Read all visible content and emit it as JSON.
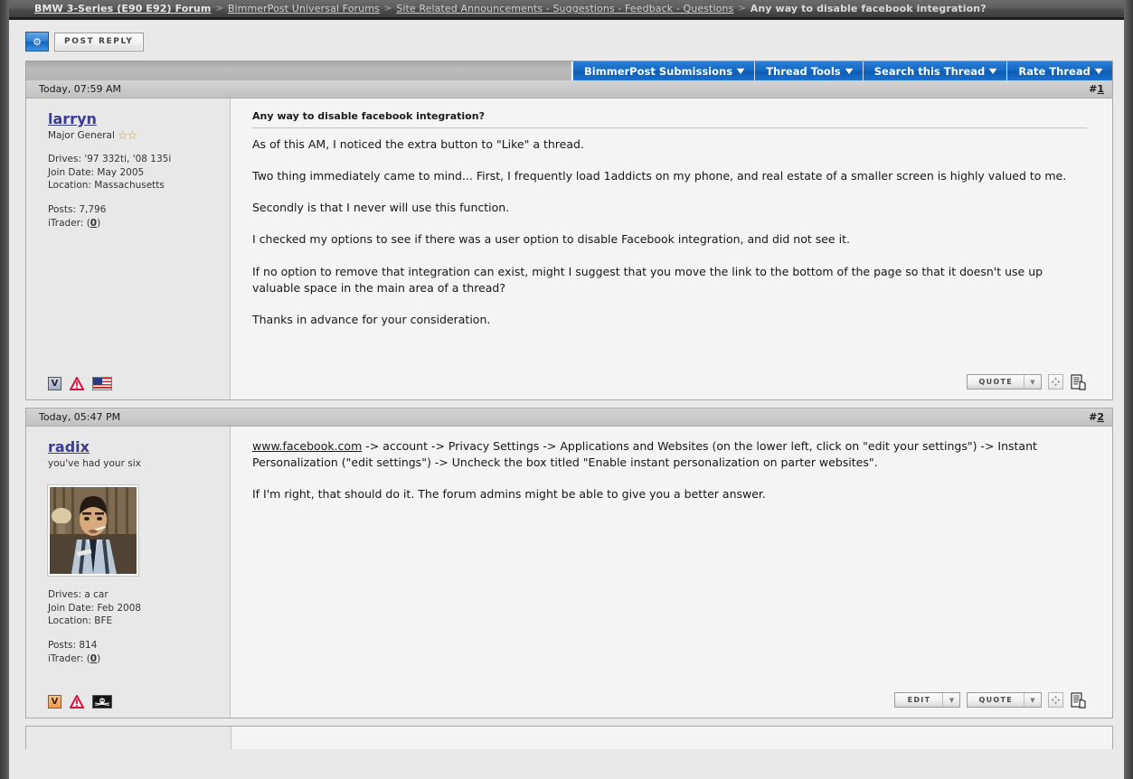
{
  "breadcrumb": {
    "items": [
      {
        "label": "BMW 3-Series (E90 E92) Forum",
        "style": "bold-link"
      },
      {
        "label": "BimmerPost Universal Forums",
        "style": "link"
      },
      {
        "label": "Site Related Announcements - Suggestions - Feedback - Questions",
        "style": "link"
      },
      {
        "label": "Any way to disable facebook integration?",
        "style": "current"
      }
    ],
    "separator": ">"
  },
  "toolbar": {
    "new_icon": "new-thread-icon",
    "post_reply_label": "Post Reply"
  },
  "tabs": [
    {
      "label": "BimmerPost Submissions",
      "caret": "▼"
    },
    {
      "label": "Thread Tools",
      "caret": "▼"
    },
    {
      "label": "Search this Thread",
      "caret": "▼"
    },
    {
      "label": "Rate Thread",
      "caret": "▼"
    }
  ],
  "posts": [
    {
      "timestamp": "Today, 07:59 AM",
      "number_prefix": "#",
      "number": "1",
      "user": {
        "name": "larryn",
        "title": "Major General",
        "stars": "☆☆",
        "star_count": 2,
        "drives_label": "Drives:",
        "drives": "'97 332ti, '08 135i",
        "join_label": "Join Date:",
        "join_date": "May 2005",
        "location_label": "Location:",
        "location": "Massachusetts",
        "posts_label": "Posts:",
        "posts": "7,796",
        "itrader_label": "iTrader:",
        "itrader_open": "(",
        "itrader_count": "0",
        "itrader_close": ")",
        "has_avatar": false,
        "badges": [
          "v-badge-icon",
          "report-warning-icon",
          "us-flag-icon"
        ]
      },
      "title": "Any way to disable facebook integration?",
      "paragraphs": [
        "As of this AM, I noticed the extra button to \"Like\" a thread.",
        "Two thing immediately came to mind... First, I frequently load 1addicts on my phone, and real estate of a smaller screen is highly valued to me.",
        "Secondly is that I never will use this function.",
        "I checked my options to see if there was a user option to disable Facebook integration, and did not see it.",
        "If no option to remove that integration can exist, might I suggest that you move the link to the bottom of the page so that it doesn't use up valuable space in the main area of a thread?",
        "Thanks in advance for your consideration."
      ],
      "link": null,
      "actions": [
        {
          "label": "Quote",
          "has_arrow": true
        }
      ],
      "action_icons": [
        "multiquote-icon",
        "reply-with-quote-icon"
      ]
    },
    {
      "timestamp": "Today, 05:47 PM",
      "number_prefix": "#",
      "number": "2",
      "user": {
        "name": "radix",
        "title": "you've had your six",
        "stars": "",
        "star_count": 0,
        "drives_label": "Drives:",
        "drives": "a car",
        "join_label": "Join Date:",
        "join_date": "Feb 2008",
        "location_label": "Location:",
        "location": "BFE",
        "posts_label": "Posts:",
        "posts": "814",
        "itrader_label": "iTrader:",
        "itrader_open": "(",
        "itrader_count": "0",
        "itrader_close": ")",
        "has_avatar": true,
        "avatar_alt": "user-avatar-photo",
        "badges": [
          "v-badge-icon",
          "report-warning-icon",
          "pirate-flag-icon"
        ]
      },
      "title": null,
      "link_text": "www.facebook.com",
      "paragraphs": [
        " -> account -> Privacy Settings -> Applications and Websites (on the lower left, click on \"edit your settings\") -> Instant Personalization (\"edit settings\") -> Uncheck the box titled \"Enable instant personalization on parter websites\".",
        "If I'm right, that should do it. The forum admins might be able to give you a better answer."
      ],
      "actions": [
        {
          "label": "Edit",
          "has_arrow": true
        },
        {
          "label": "Quote",
          "has_arrow": true
        }
      ],
      "action_icons": [
        "multiquote-icon",
        "reply-with-quote-icon"
      ]
    }
  ],
  "colors": {
    "tab_blue": "#1569c4",
    "link_purple": "#3b3b96",
    "chrome_dark": "#4d4d4d",
    "surface": "#e9e9e9"
  }
}
